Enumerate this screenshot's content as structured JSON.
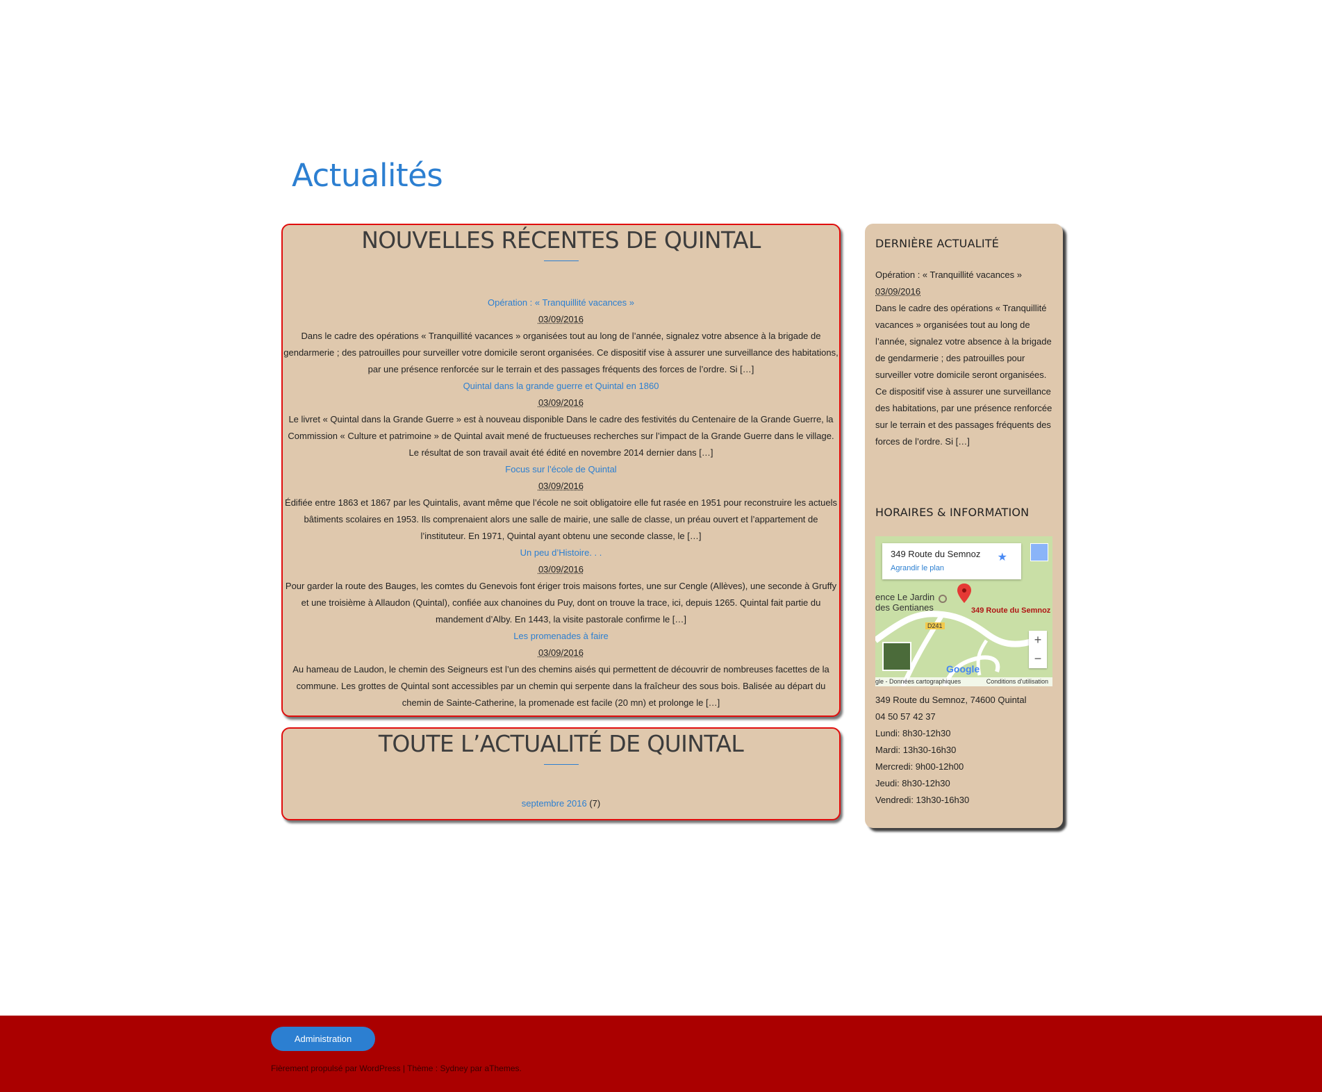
{
  "page": {
    "title": "Actualités"
  },
  "news_panel": {
    "heading": "NOUVELLES RÉCENTES DE QUINTAL",
    "items": [
      {
        "title": "Opération : « Tranquillité vacances »",
        "date": "03/09/2016",
        "excerpt": "Dans le cadre des opérations « Tranquillité vacances » organisées tout au long de l’année, signalez votre absence à la brigade de gendarmerie ; des patrouilles pour surveiller votre domicile seront organisées. Ce dispositif vise à assurer une surveillance des habitations, par une présence renforcée sur le terrain et des passages fréquents des forces de l’ordre. Si […]"
      },
      {
        "title": "Quintal dans la grande guerre et Quintal en 1860",
        "date": "03/09/2016",
        "excerpt": "Le livret « Quintal dans la Grande Guerre » est à nouveau disponible Dans le cadre des festivités du Centenaire de la Grande Guerre, la Commission « Culture et patrimoine » de Quintal avait mené de fructueuses recherches sur l’impact de la Grande Guerre dans le village. Le résultat de son travail avait été édité en novembre 2014 dernier dans […]"
      },
      {
        "title": "Focus sur l’école de Quintal",
        "date": "03/09/2016",
        "excerpt": "Édifiée entre 1863 et 1867 par les Quintalis, avant même que l’école ne soit obligatoire elle fut rasée en 1951 pour reconstruire les actuels bâtiments scolaires en 1953.  Ils comprenaient alors une salle de mairie, une salle de classe, un préau ouvert et l’appartement de l’instituteur. En 1971, Quintal ayant obtenu une seconde classe, le […]"
      },
      {
        "title": "Un peu d’Histoire. . .",
        "date": "03/09/2016",
        "excerpt": "Pour garder la route des Bauges, les comtes du Genevois font ériger trois maisons fortes, une sur Cengle (Allèves), une seconde à Gruffy et une troisième à Allaudon (Quintal), confiée aux chanoines du Puy, dont on trouve la trace, ici, depuis 1265. Quintal fait partie du mandement d’Alby. En 1443, la visite pastorale confirme le […]"
      },
      {
        "title": "Les promenades à faire",
        "date": "03/09/2016",
        "excerpt": "Au hameau de Laudon, le chemin des Seigneurs est l’un des chemins aisés qui permettent de découvrir de nombreuses facettes de la commune. Les grottes de Quintal sont accessibles par un chemin qui serpente dans la fraîcheur des sous bois. Balisée au départ du chemin de Sainte-Catherine, la promenade est facile (20 mn) et prolonge le […]"
      }
    ]
  },
  "archive_panel": {
    "heading": "TOUTE L’ACTUALITÉ DE QUINTAL",
    "month": "septembre 2016",
    "count": "(7)"
  },
  "sidebar": {
    "latest": {
      "title": "DERNIÈRE ACTUALITÉ",
      "post_title": "Opération : « Tranquillité vacances »",
      "date": "03/09/2016",
      "excerpt": "Dans le cadre des opérations « Tranquillité vacances » organisées tout au long de l’année, signalez votre absence à la brigade de gendarmerie ; des patrouilles pour surveiller votre domicile seront organisées. Ce dispositif vise à assurer une surveillance des habitations, par une présence renforcée sur le terrain et des passages fréquents des forces de l’ordre. Si […]"
    },
    "info": {
      "title": "HORAIRES & INFORMATION",
      "map": {
        "card_title": "349 Route du Semnoz",
        "card_link": "Agrandir le plan",
        "place_label_1": "ence Le Jardin",
        "place_label_2": "des Gentianes",
        "pin_label": "349 Route du Semnoz",
        "road_label": "D241",
        "zoom_in": "+",
        "zoom_out": "−",
        "brand": "Google",
        "footer_left": "gle - Données cartographiques",
        "footer_right": "Conditions d'utilisation"
      },
      "address": "349 Route du Semnoz, 74600 Quintal",
      "phone": "04 50 57 42 37",
      "hours": [
        "Lundi: 8h30-12h30",
        "Mardi: 13h30-16h30",
        "Mercredi: 9h00-12h00",
        "Jeudi: 8h30-12h30",
        "Vendredi: 13h30-16h30"
      ]
    }
  },
  "footer": {
    "admin_label": "Administration",
    "credit_1": "Fièrement propulsé par WordPress",
    "separator": " | ",
    "credit_2": "Thème : Sydney par aThemes."
  },
  "colors": {
    "accent": "#2c7fd1",
    "panel_bg": "#dfc8ad",
    "panel_border": "#e00d0d",
    "footer_bg": "#aa0000"
  }
}
